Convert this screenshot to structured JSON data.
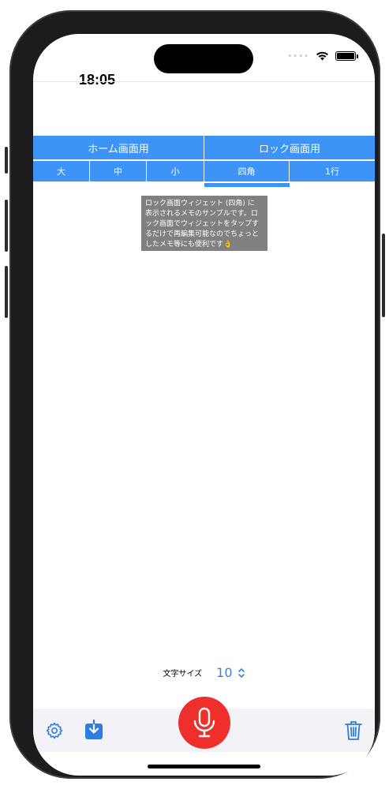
{
  "status_bar": {
    "time": "18:05",
    "signal": "••••"
  },
  "tabs": {
    "top": [
      {
        "label": "ホーム画面用"
      },
      {
        "label": "ロック画面用"
      }
    ],
    "sub": [
      {
        "label": "大"
      },
      {
        "label": "中"
      },
      {
        "label": "小"
      },
      {
        "label": "四角"
      },
      {
        "label": "1行"
      }
    ],
    "selected_top": "ロック画面用",
    "selected_sub": "四角"
  },
  "memo_preview": {
    "text": "ロック画面ウィジェット (四角) に\n表示されるメモのサンプルです。ロ\nック画面でウィジェットをタップす\nるだけで再編集可能なのでちょっと\nしたメモ等にも便利です👌"
  },
  "font_size": {
    "label": "文字サイズ",
    "value": "10"
  },
  "toolbar": {
    "settings_icon": "gear-icon",
    "save_icon": "download-icon",
    "mic_icon": "microphone-icon",
    "delete_icon": "trash-icon"
  },
  "colors": {
    "accent_blue": "#3d94f6",
    "mic_red": "#ef2f2c",
    "memo_bg": "#808080"
  }
}
